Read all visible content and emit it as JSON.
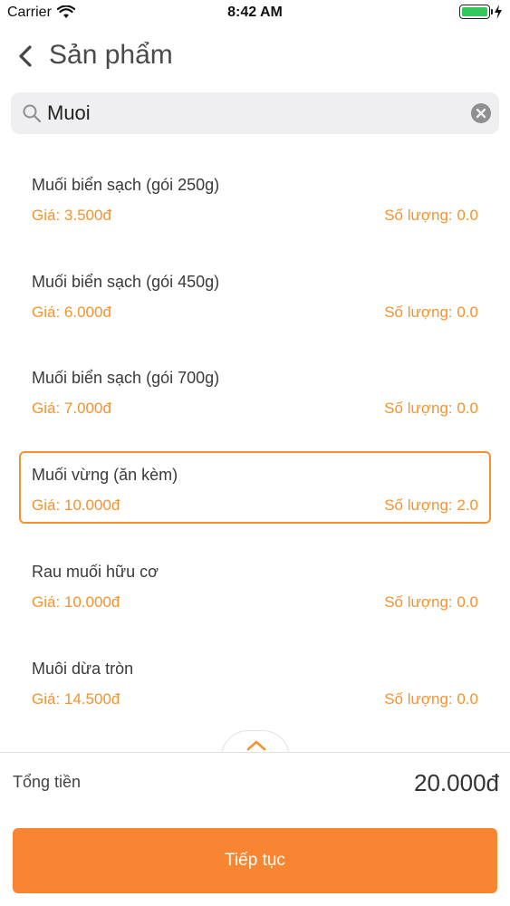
{
  "status_bar": {
    "carrier": "Carrier",
    "time": "8:42 AM",
    "battery_color": "#34c759"
  },
  "nav": {
    "back_icon": "chevron-left-icon",
    "title": "Sản phẩm"
  },
  "search": {
    "value": "Muoi",
    "icon": "search-icon",
    "clear_icon": "clear-icon"
  },
  "products": [
    {
      "name": "Muối biển sạch (gói 250g)",
      "price": "Giá: 3.500đ",
      "quantity": "Số lượng: 0.0",
      "selected": false
    },
    {
      "name": "Muối biển sạch (gói 450g)",
      "price": "Giá: 6.000đ",
      "quantity": "Số lượng: 0.0",
      "selected": false
    },
    {
      "name": "Muối biển sạch (gói 700g)",
      "price": "Giá: 7.000đ",
      "quantity": "Số lượng: 0.0",
      "selected": false
    },
    {
      "name": "Muối vừng (ăn kèm)",
      "price": "Giá: 10.000đ",
      "quantity": "Số lượng: 2.0",
      "selected": true
    },
    {
      "name": "Rau muối hữu cơ",
      "price": "Giá: 10.000đ",
      "quantity": "Số lượng: 0.0",
      "selected": false
    },
    {
      "name": "Muôi dừa tròn",
      "price": "Giá: 14.500đ",
      "quantity": "Số lượng: 0.0",
      "selected": false
    }
  ],
  "summary": {
    "total_label": "Tổng tiền",
    "total_value": "20.000đ",
    "expand_icon": "chevron-up-icon"
  },
  "actions": {
    "continue_label": "Tiếp tục"
  },
  "colors": {
    "accent": "#f5922e",
    "button": "#f78532"
  }
}
